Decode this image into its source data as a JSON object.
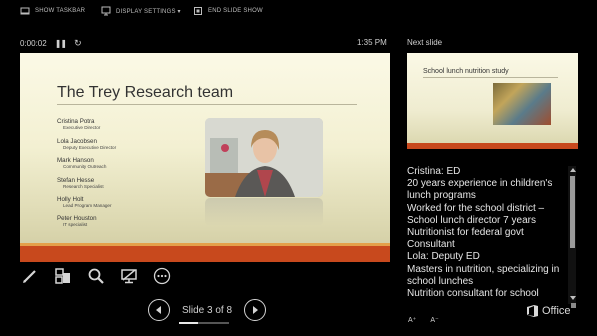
{
  "toolbar": {
    "show_taskbar": "SHOW TASKBAR",
    "display_settings": "DISPLAY SETTINGS ▾",
    "end_slide_show": "END SLIDE SHOW"
  },
  "timer": {
    "elapsed": "0:00:02",
    "clock": "1:35 PM"
  },
  "slide": {
    "title": "The Trey Research team",
    "people": [
      {
        "name": "Cristina Potra",
        "role": "Executive Director"
      },
      {
        "name": "Lola Jacobsen",
        "role": "Deputy Executive Director"
      },
      {
        "name": "Mark Hanson",
        "role": "Community Outreach"
      },
      {
        "name": "Stefan Hesse",
        "role": "Research Specialist"
      },
      {
        "name": "Holly Holt",
        "role": "Lead Program Manager"
      },
      {
        "name": "Peter Houston",
        "role": "IT specialist"
      }
    ]
  },
  "navigation": {
    "slide_counter": "Slide 3 of 8",
    "progress": 0.375
  },
  "next_slide": {
    "label": "Next slide",
    "title": "School lunch nutrition study"
  },
  "notes": [
    "Cristina: ED",
    "20 years experience in children's lunch programs",
    "Worked for the school district – School lunch director 7 years",
    "Nutritionist for federal govt",
    "Consultant",
    "Lola: Deputy ED",
    "Masters in nutrition, specializing in school lunches",
    "Nutrition consultant for school"
  ],
  "font_controls": {
    "increase": "A⁺",
    "decrease": "A⁻"
  },
  "brand": {
    "office": "Office"
  },
  "colors": {
    "accent": "#c8491d",
    "background": "#000000"
  }
}
